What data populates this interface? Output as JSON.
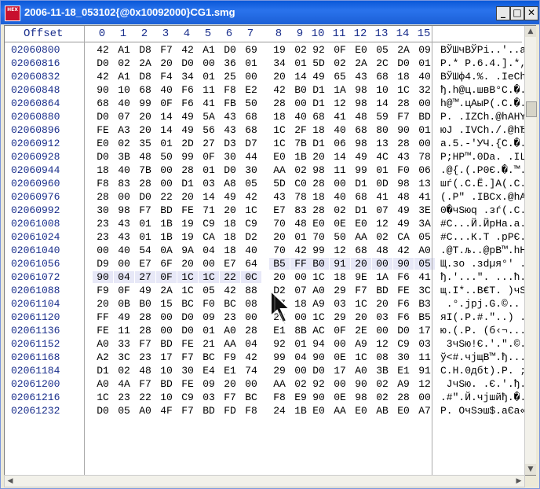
{
  "window": {
    "title": "2006-11-18_053102{@0x10092000}CG1.smg",
    "app_icon": "hex-editor-icon",
    "app_icon_text": "HEX"
  },
  "header": {
    "offset_label": "Offset",
    "columns": [
      "0",
      "1",
      "2",
      "3",
      "4",
      "5",
      "6",
      "7",
      "8",
      "9",
      "10",
      "11",
      "12",
      "13",
      "14",
      "15"
    ]
  },
  "rows": [
    {
      "offset": "02060800",
      "hex": [
        "42",
        "A1",
        "D8",
        "F7",
        "42",
        "A1",
        "D0",
        "69",
        "19",
        "02",
        "92",
        "0F",
        "E0",
        "05",
        "2A",
        "09"
      ],
      "ascii": "ВЎШчВЎРi..'..а.*."
    },
    {
      "offset": "02060816",
      "hex": [
        "D0",
        "02",
        "2A",
        "20",
        "D0",
        "00",
        "36",
        "01",
        "34",
        "01",
        "5D",
        "02",
        "2A",
        "2C",
        "D0",
        "01"
      ],
      "ascii": "Р.* Р.6.4.].*,Р."
    },
    {
      "offset": "02060832",
      "hex": [
        "42",
        "A1",
        "D8",
        "F4",
        "34",
        "01",
        "25",
        "00",
        "20",
        "14",
        "49",
        "65",
        "43",
        "68",
        "18",
        "40"
      ],
      "ascii": "ВЎШф4.%. .IeCh.@"
    },
    {
      "offset": "02060848",
      "hex": [
        "90",
        "10",
        "68",
        "40",
        "F6",
        "11",
        "F8",
        "E2",
        "42",
        "B0",
        "D1",
        "1A",
        "98",
        "10",
        "1C",
        "32"
      ],
      "ascii": "ђ.h@ц.швВ°С.�..2"
    },
    {
      "offset": "02060864",
      "hex": [
        "68",
        "40",
        "99",
        "0F",
        "F6",
        "41",
        "FB",
        "50",
        "28",
        "00",
        "D1",
        "12",
        "98",
        "14",
        "28",
        "00"
      ],
      "ascii": "h@™.цAыP(.С.�.(."
    },
    {
      "offset": "02060880",
      "hex": [
        "D0",
        "07",
        "20",
        "14",
        "49",
        "5A",
        "43",
        "68",
        "18",
        "40",
        "68",
        "41",
        "48",
        "59",
        "F7",
        "BD"
      ],
      "ascii": "Р. .IZCh.@hAHYчЅ"
    },
    {
      "offset": "02060896",
      "hex": [
        "FE",
        "A3",
        "20",
        "14",
        "49",
        "56",
        "43",
        "68",
        "1C",
        "2F",
        "18",
        "40",
        "68",
        "80",
        "90",
        "01"
      ],
      "ascii": "юЈ .IVCh./.@hЂђ."
    },
    {
      "offset": "02060912",
      "hex": [
        "E0",
        "02",
        "35",
        "01",
        "2D",
        "27",
        "D3",
        "D7",
        "1C",
        "7B",
        "D1",
        "06",
        "98",
        "13",
        "28",
        "00"
      ],
      "ascii": "а.5.-'УЧ.{С.�.(."
    },
    {
      "offset": "02060928",
      "hex": [
        "D0",
        "3B",
        "48",
        "50",
        "99",
        "0F",
        "30",
        "44",
        "E0",
        "1B",
        "20",
        "14",
        "49",
        "4C",
        "43",
        "78"
      ],
      "ascii": "Р;HP™.0Dа. .ILCx"
    },
    {
      "offset": "02060944",
      "hex": [
        "18",
        "40",
        "7B",
        "00",
        "28",
        "01",
        "D0",
        "30",
        "AA",
        "02",
        "98",
        "11",
        "99",
        "01",
        "F0",
        "06"
      ],
      "ascii": ".@{.(.Р0Є.�.™.р."
    },
    {
      "offset": "02060960",
      "hex": [
        "F8",
        "83",
        "28",
        "00",
        "D1",
        "03",
        "A8",
        "05",
        "5D",
        "C0",
        "28",
        "00",
        "D1",
        "0D",
        "98",
        "13"
      ],
      "ascii": "шѓ(.С.Ё.]А(.С.�."
    },
    {
      "offset": "02060976",
      "hex": [
        "28",
        "00",
        "D0",
        "22",
        "20",
        "14",
        "49",
        "42",
        "43",
        "78",
        "18",
        "40",
        "68",
        "41",
        "48",
        "41"
      ],
      "ascii": "(.Р\" .IBCx.@hAHA"
    },
    {
      "offset": "02060992",
      "hex": [
        "30",
        "98",
        "F7",
        "BD",
        "FE",
        "71",
        "20",
        "1C",
        "E7",
        "83",
        "28",
        "02",
        "D1",
        "07",
        "49",
        "3E"
      ],
      "ascii": "0�чЅюq .зѓ(.С.I>"
    },
    {
      "offset": "02061008",
      "hex": [
        "23",
        "43",
        "01",
        "1B",
        "19",
        "C9",
        "18",
        "C9",
        "70",
        "48",
        "E0",
        "0E",
        "E0",
        "12",
        "49",
        "3A"
      ],
      "ascii": "#C...Й.ЙpHа.а.I:"
    },
    {
      "offset": "02061024",
      "hex": [
        "23",
        "43",
        "01",
        "1B",
        "19",
        "CA",
        "18",
        "D2",
        "20",
        "01",
        "70",
        "50",
        "AA",
        "02",
        "CA",
        "05"
      ],
      "ascii": "#C...К.Т .pPЄ.К."
    },
    {
      "offset": "02061040",
      "hex": [
        "00",
        "40",
        "54",
        "0A",
        "9A",
        "04",
        "18",
        "40",
        "70",
        "42",
        "99",
        "12",
        "68",
        "48",
        "42",
        "A0"
      ],
      "ascii": ".@T.љ..@pB™.hHB "
    },
    {
      "offset": "02061056",
      "hex": [
        "D9",
        "00",
        "E7",
        "6F",
        "20",
        "00",
        "E7",
        "64",
        "B5",
        "FF",
        "B0",
        "91",
        "20",
        "00",
        "90",
        "05"
      ],
      "ascii": "Щ.зо .зdµя°' .ђ."
    },
    {
      "offset": "02061072",
      "hex": [
        "90",
        "04",
        "27",
        "0F",
        "1C",
        "1C",
        "22",
        "0C",
        "20",
        "00",
        "1C",
        "18",
        "9E",
        "1A",
        "F6",
        "41"
      ],
      "ascii": "ђ.'...\". ...ћ.цA"
    },
    {
      "offset": "02061088",
      "hex": [
        "F9",
        "0F",
        "49",
        "2A",
        "1C",
        "05",
        "42",
        "88",
        "D2",
        "07",
        "A0",
        "29",
        "F7",
        "BD",
        "FE",
        "3C"
      ],
      "ascii": "щ.I*..B€Т. )чЅю<"
    },
    {
      "offset": "02061104",
      "hex": [
        "20",
        "0B",
        "B0",
        "15",
        "BC",
        "F0",
        "BC",
        "08",
        "47",
        "18",
        "A9",
        "03",
        "1C",
        "20",
        "F6",
        "B3"
      ],
      "ascii": " .°.јрј.G.©.. ці"
    },
    {
      "offset": "02061120",
      "hex": [
        "FF",
        "49",
        "28",
        "00",
        "D0",
        "09",
        "23",
        "00",
        "22",
        "00",
        "1C",
        "29",
        "20",
        "03",
        "F6",
        "B5"
      ],
      "ascii": "яI(.Р.#.\"..) .цµ"
    },
    {
      "offset": "02061136",
      "hex": [
        "FE",
        "11",
        "28",
        "00",
        "D0",
        "01",
        "A0",
        "28",
        "E1",
        "8B",
        "AC",
        "0F",
        "2E",
        "00",
        "D0",
        "17"
      ],
      "ascii": "ю.(.Р. (б‹¬...Р."
    },
    {
      "offset": "02061152",
      "hex": [
        "A0",
        "33",
        "F7",
        "BD",
        "FE",
        "21",
        "AA",
        "04",
        "92",
        "01",
        "94",
        "00",
        "A9",
        "12",
        "C9",
        "03"
      ],
      "ascii": " 3чЅю!Є.'.\".©.Й."
    },
    {
      "offset": "02061168",
      "hex": [
        "A2",
        "3C",
        "23",
        "17",
        "F7",
        "BC",
        "F9",
        "42",
        "99",
        "04",
        "90",
        "0E",
        "1C",
        "08",
        "30",
        "11"
      ],
      "ascii": "ў<#.чјщB™.ђ...0."
    },
    {
      "offset": "02061184",
      "hex": [
        "D1",
        "02",
        "48",
        "10",
        "30",
        "E4",
        "E1",
        "74",
        "29",
        "00",
        "D0",
        "17",
        "A0",
        "3B",
        "E1",
        "91"
      ],
      "ascii": "С.H.0дбt).Р. ;б'"
    },
    {
      "offset": "02061200",
      "hex": [
        "A0",
        "4A",
        "F7",
        "BD",
        "FE",
        "09",
        "20",
        "00",
        "AA",
        "02",
        "92",
        "00",
        "90",
        "02",
        "A9",
        "12"
      ],
      "ascii": " JчЅю. .Є.'.ђ.©."
    },
    {
      "offset": "02061216",
      "hex": [
        "1C",
        "23",
        "22",
        "10",
        "C9",
        "03",
        "F7",
        "BC",
        "F8",
        "E9",
        "90",
        "0E",
        "98",
        "02",
        "28",
        "00"
      ],
      "ascii": ".#\".Й.чјшйђ.�.(."
    },
    {
      "offset": "02061232",
      "hex": [
        "D0",
        "05",
        "A0",
        "4F",
        "F7",
        "BD",
        "FD",
        "F8",
        "24",
        "1B",
        "E0",
        "AA",
        "E0",
        "AB",
        "E0",
        "A7"
      ],
      "ascii": "Р. OчЅэш$.аЄа«а§"
    }
  ],
  "selection_start_row": 16,
  "selection_start_col": 8,
  "selection_end_row": 17,
  "selection_end_col": 7,
  "icons": {
    "minimize": "minimize-icon",
    "maximize": "maximize-icon",
    "close": "close-icon",
    "scroll_up": "arrow-up-icon",
    "scroll_down": "arrow-down-icon",
    "scroll_left": "arrow-left-icon",
    "scroll_right": "arrow-right-icon",
    "cursor": "mouse-pointer-icon"
  },
  "glyphs": {
    "minimize": "_",
    "maximize": "□",
    "close": "✕",
    "up": "▲",
    "down": "▼",
    "left": "◀",
    "right": "▶"
  }
}
